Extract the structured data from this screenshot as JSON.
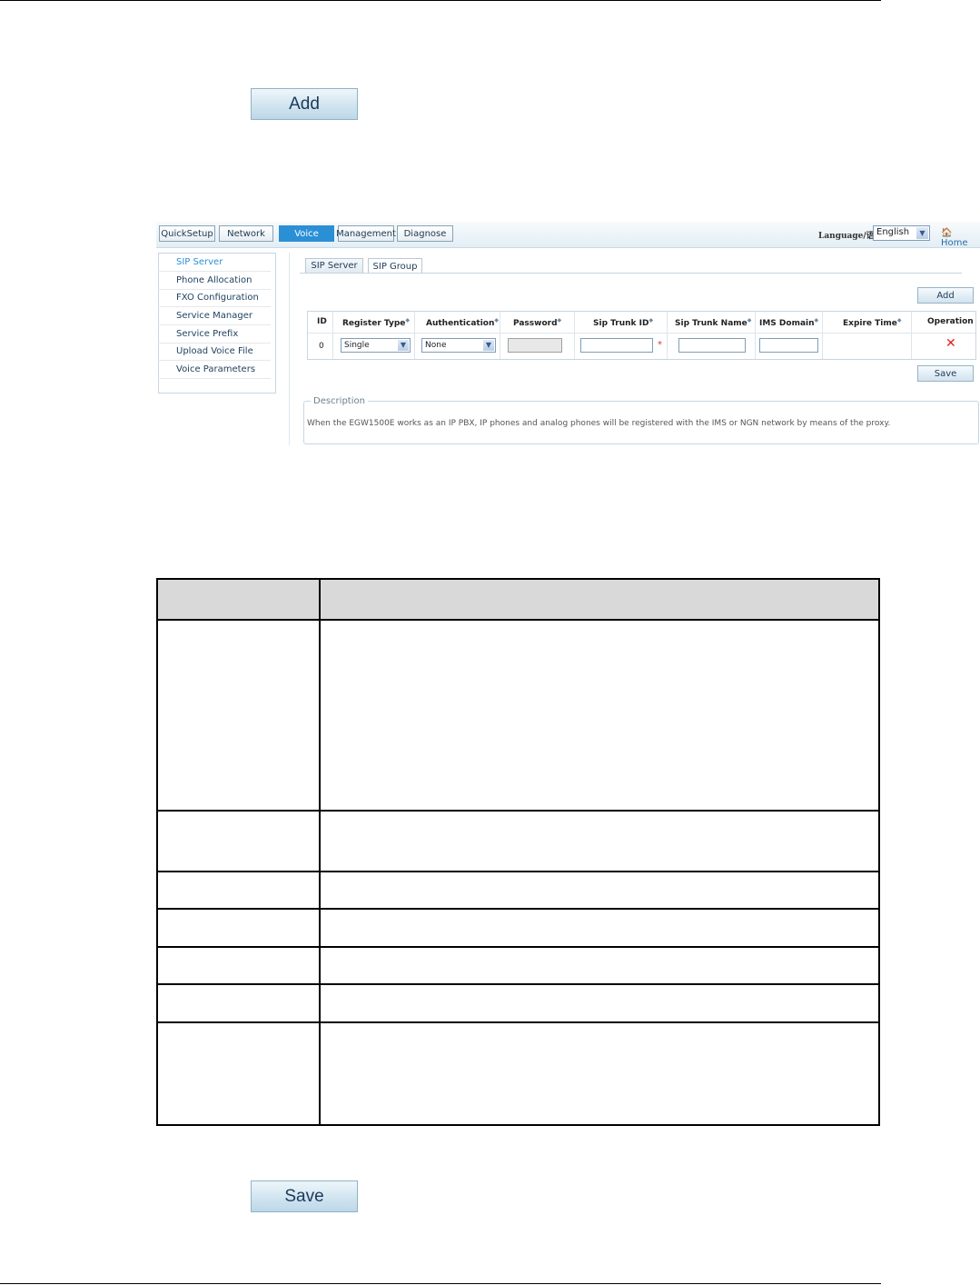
{
  "doc": {
    "add_button": "Add",
    "save_button": "Save"
  },
  "screenshot": {
    "nav": [
      "QuickSetup",
      "Network",
      "Voice",
      "Management",
      "Diagnose"
    ],
    "language_label": "Language/语言:",
    "language_value": "English",
    "home": "Home",
    "sidebar": [
      "SIP Server",
      "Phone Allocation",
      "FXO Configuration",
      "Service Manager",
      "Service Prefix",
      "Upload Voice File",
      "Voice Parameters"
    ],
    "tabs": [
      "SIP Server",
      "SIP Group"
    ],
    "add_button": "Add",
    "save_button": "Save",
    "columns": [
      "ID",
      "Register Type",
      "Authentication",
      "Password",
      "Sip Trunk ID",
      "Sip Trunk Name",
      "IMS Domain",
      "Expire Time",
      "Operation"
    ],
    "row": {
      "id": "0",
      "register_type": "Single",
      "authentication": "None",
      "password": "",
      "sip_trunk_id": "",
      "sip_trunk_name": "",
      "ims_domain": "",
      "expire_time": ""
    },
    "description_legend": "Description",
    "description_text": "When the EGW1500E works as an IP PBX, IP phones and analog phones will be registered with the IMS or NGN network by means of the proxy."
  },
  "colors": {
    "active_nav": "#2b8fd6",
    "delete_icon": "#e02020",
    "table_header": "#d9d9d9"
  }
}
